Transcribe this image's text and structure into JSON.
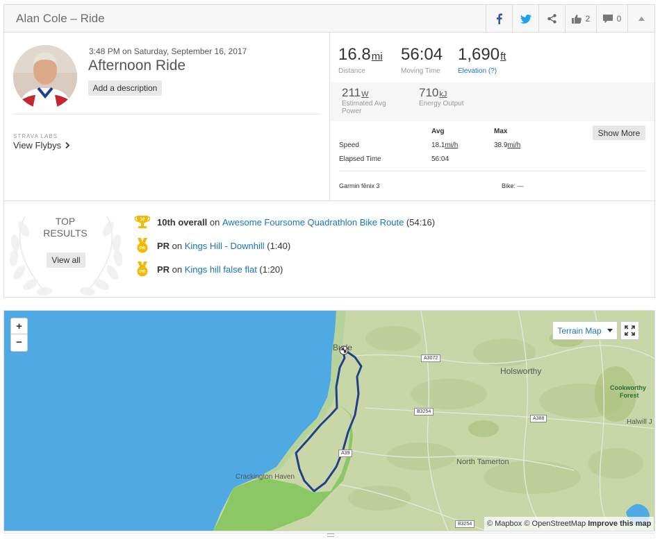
{
  "header": {
    "title": "Alan Cole – Ride",
    "kudos_count": "2",
    "comments_count": "0"
  },
  "activity": {
    "datetime": "3:48 PM on Saturday, September 16, 2017",
    "name": "Afternoon Ride",
    "add_description": "Add a description",
    "labs_label": "STRAVA LABS",
    "flyby_label": "View Flybys"
  },
  "stats": {
    "distance": {
      "value": "16.8",
      "unit": "mi",
      "label": "Distance"
    },
    "moving_time": {
      "value": "56:04",
      "label": "Moving Time"
    },
    "elevation": {
      "value": "1,690",
      "unit": "ft",
      "label": "Elevation (?)"
    },
    "power": {
      "value": "211",
      "unit": "W",
      "label_line1": "Estimated Avg",
      "label_line2": "Power"
    },
    "energy": {
      "value": "710",
      "unit": "kJ",
      "label": "Energy Output"
    },
    "table": {
      "avg_header": "Avg",
      "max_header": "Max",
      "speed_label": "Speed",
      "speed_avg": "18.1",
      "speed_max": "38.9",
      "speed_unit": "mi/h",
      "elapsed_label": "Elapsed Time",
      "elapsed_value": "56:04"
    },
    "show_more": "Show More",
    "device": "Garmin fēnix 3",
    "bike": "Bike: —"
  },
  "results": {
    "title_line1": "TOP",
    "title_line2": "RESULTS",
    "view_all": "View all",
    "items": [
      {
        "badge": "10",
        "rank": "10th overall",
        "on": " on ",
        "segment": "Awesome Foursome Quadrathlon Bike Route",
        "time": " (54:16)"
      },
      {
        "badge": "PR",
        "rank": "PR",
        "on": " on ",
        "segment": "Kings Hill - Downhill",
        "time": " (1:40)"
      },
      {
        "badge": "PR",
        "rank": "PR",
        "on": " on ",
        "segment": "Kings hill false flat",
        "time": " (1:20)"
      }
    ]
  },
  "map": {
    "zoom_in": "+",
    "zoom_out": "−",
    "terrain_label": "Terrain Map",
    "attribution_mapbox": "© Mapbox ",
    "attribution_osm": "© OpenStreetMap ",
    "attribution_improve": "Improve this map",
    "places": {
      "holsworthy": "Holsworthy",
      "cookworthy1": "Cookworthy",
      "cookworthy2": "Forest",
      "north_tamerton": "North Tamerton",
      "crackington": "Crackington Haven",
      "halwill": "Halwill J",
      "bude": "Bude"
    },
    "roads": {
      "a3072": "A3072",
      "b3254a": "B3254",
      "a388": "A388",
      "a39": "A39",
      "b3254b": "B3254"
    },
    "colors": {
      "sea": "#4fa9e3",
      "land": "#c8d6a8",
      "park": "#8cc766",
      "route": "#20418a"
    }
  }
}
